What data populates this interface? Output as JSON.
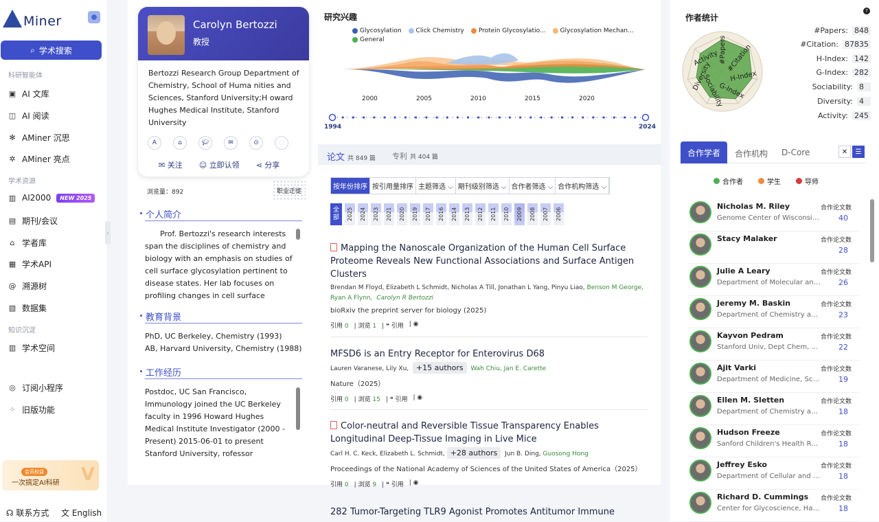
{
  "app": {
    "logo_text": "Miner"
  },
  "sidebar": {
    "search_label": "学术搜索",
    "section1": "科研智能体",
    "items1": [
      {
        "label": "AI 文库",
        "icon": "library-icon"
      },
      {
        "label": "AI 阅读",
        "icon": "reader-icon"
      },
      {
        "label": "AMiner 沉思",
        "icon": "think-icon"
      },
      {
        "label": "AMiner 亮点",
        "icon": "highlight-icon"
      }
    ],
    "section2": "学术资源",
    "items2": [
      {
        "label": "AI2000",
        "icon": "chart-icon"
      },
      {
        "label": "期刊/会议",
        "icon": "journal-icon"
      },
      {
        "label": "学者库",
        "icon": "scholar-icon"
      },
      {
        "label": "学术API",
        "icon": "api-icon"
      },
      {
        "label": "溯源树",
        "icon": "tree-icon"
      },
      {
        "label": "数据集",
        "icon": "dataset-icon"
      }
    ],
    "new_badge": "NEW 2025",
    "section3": "知识沉淀",
    "items3": [
      {
        "label": "学术空间",
        "icon": "space-icon"
      }
    ],
    "items4": [
      {
        "label": "订阅小程序",
        "icon": "subscribe-icon"
      },
      {
        "label": "旧版功能",
        "icon": "legacy-icon"
      }
    ],
    "promo_tag": "会员权益",
    "promo_text": "一次搞定AI科研",
    "contact": "联系方式",
    "language": "English"
  },
  "profile": {
    "name": "Carolyn Bertozzi",
    "title": "教授",
    "affiliation": "Bertozzi Research Group Department of Chemistry, School of Huma nities and Sciences, Stanford University;H oward Hughes Medical Institute, Stanford University",
    "follow": "关注",
    "claim": "立即认领",
    "share": "分享",
    "views_label": "浏览量：892",
    "career_map": "职业迁徙",
    "bio_title": "个人简介",
    "bio": "Prof. Bertozzi's research interests span the disciplines of chemistry and biology with an emphasis on studies of cell surface glycosylation pertinent to disease states. Her lab focuses on profiling changes in cell surface",
    "edu_title": "教育背景",
    "edu": [
      "PhD, UC Berkeley, Chemistry (1993)",
      "AB, Harvard University, Chemistry (1988)"
    ],
    "work_title": "工作经历",
    "work": "Postdoc, UC San Francisco, Immunology joined the UC Berkeley faculty in 1996 Howard Hughes Medical Institute Investigator (2000 - Present) 2015-06-01 to present Stanford University, rofessor"
  },
  "interests": {
    "title": "研究兴趣",
    "legend": [
      {
        "label": "Glycosylation",
        "color": "#3b5fb0"
      },
      {
        "label": "Click Chemistry",
        "color": "#a9c4ea"
      },
      {
        "label": "Protein Glycosylatio...",
        "color": "#f08a3c"
      },
      {
        "label": "Glycosylation Mechan...",
        "color": "#f6b878"
      },
      {
        "label": "General",
        "color": "#4caf50"
      }
    ],
    "axis_years": [
      "2000",
      "2005",
      "2010",
      "2015",
      "2020"
    ],
    "range_start": "1994",
    "range_end": "2024"
  },
  "papers_tab": {
    "papers_label": "论文",
    "papers_count": "共 849 篇",
    "patents_label": "专利",
    "patents_count": "共 404 篇",
    "filters": [
      "按年份排序",
      "按引用量排序",
      "主题筛选 ⌵",
      "期刊级别筛选 ⌵",
      "合作者筛选 ⌵",
      "合作机构筛选 ⌵"
    ],
    "all_label": "全部",
    "years": [
      "2025",
      "2024",
      "2023",
      "2021",
      "2020",
      "2019",
      "2017",
      "2016",
      "2014",
      "2013",
      "2012",
      "2011",
      "2010",
      "2009",
      "2008",
      "2007",
      "2006"
    ]
  },
  "papers": [
    {
      "title": "Mapping the Nanoscale Organization of the Human Cell Surface Proteome Reveals New Functional Associations and Surface Antigen Clusters",
      "authors": "Brendan M Floyd,  Elizabeth L Schmidt,  Nicholas A Till,  Jonathan L Yang,  Pinyu Liao,",
      "authors_green": "Benson M George,",
      "authors_green2": "Ryan A Flynn,",
      "authors_italic": "Carolyn R Bertozzi",
      "venue": "bioRxiv the preprint server for biology (2025)",
      "cite_label": "引用",
      "cite": "0",
      "view_label": "浏览",
      "views": "1",
      "quote": "引用"
    },
    {
      "title": "MFSD6 is an Entry Receptor for Enterovirus D68",
      "authors": "Lauren Varanese,  Lily Xu,",
      "more": "+15 authors",
      "authors_green": "Wah Chiu,  Jan E. Carette",
      "venue": "Nature（2025）",
      "cite_label": "引用",
      "cite": "0",
      "view_label": "浏览",
      "views": "15",
      "quote": "引用"
    },
    {
      "title": "Color-neutral and Reversible Tissue Transparency Enables Longitudinal Deep-Tissue Imaging in Live Mice",
      "authors": "Carl H. C. Keck,  Elizabeth L. Schmidt,",
      "more": "+28 authors",
      "authors2": "Jun B. Ding,",
      "authors_green": "Guosong Hong",
      "venue": "Proceedings of the National Academy of Sciences of the United States of America（2025）",
      "cite_label": "引用",
      "cite": "0",
      "view_label": "浏览",
      "views": "9",
      "quote": "引用"
    },
    {
      "title": "282 Tumor-Targeting TLR9 Agonist Promotes Antitumor Immune"
    }
  ],
  "stats": {
    "title": "作者统计",
    "items": [
      {
        "label": "#Papers:",
        "value": "848"
      },
      {
        "label": "#Citation:",
        "value": "87835"
      },
      {
        "label": "H-Index:",
        "value": "142"
      },
      {
        "label": "G-Index:",
        "value": "282"
      },
      {
        "label": "Sociability:",
        "value": "8"
      },
      {
        "label": "Diversity:",
        "value": "4"
      },
      {
        "label": "Activity:",
        "value": "245"
      }
    ],
    "radar_labels": [
      "#Papers",
      "#Citation",
      "H-Index",
      "G-Index",
      "Sociability",
      "Diversity",
      "Activity"
    ]
  },
  "collab": {
    "tabs": [
      "合作学者",
      "合作机构",
      "D-Core"
    ],
    "legend": [
      {
        "label": "合作者",
        "color": "#4caf50"
      },
      {
        "label": "学生",
        "color": "#f08a3c"
      },
      {
        "label": "导师",
        "color": "#d93a3a"
      }
    ],
    "count_label": "合作论文数",
    "people": [
      {
        "name": "Nicholas M. Riley",
        "org": "Genome Center of Wisconsin, University of Wisconsin",
        "count": "40"
      },
      {
        "name": "Stacy Malaker",
        "org": "",
        "count": "28"
      },
      {
        "name": "Julie A Leary",
        "org": "Department of Molecular and Cellular Biology",
        "count": "26"
      },
      {
        "name": "Jeremy M. Baskin",
        "org": "Department of Chemistry and Chemical Biology",
        "count": "23"
      },
      {
        "name": "Kayvon Pedram",
        "org": "Stanford Univ, Dept Chem, Stanford",
        "count": "22"
      },
      {
        "name": "Ajit Varki",
        "org": "Department of Medicine, School of Medicine",
        "count": "19"
      },
      {
        "name": "Ellen M. Sletten",
        "org": "Department of Chemistry and Biochemistry",
        "count": "18"
      },
      {
        "name": "Hudson Freeze",
        "org": "Sanford Children's Health Research Center",
        "count": "18"
      },
      {
        "name": "Jeffrey Esko",
        "org": "Department of Cellular and Molecular Medicine",
        "count": "18"
      },
      {
        "name": "Richard D. Cummings",
        "org": "Center for Glycoscience, Harvard Medical School",
        "count": "18"
      }
    ]
  }
}
